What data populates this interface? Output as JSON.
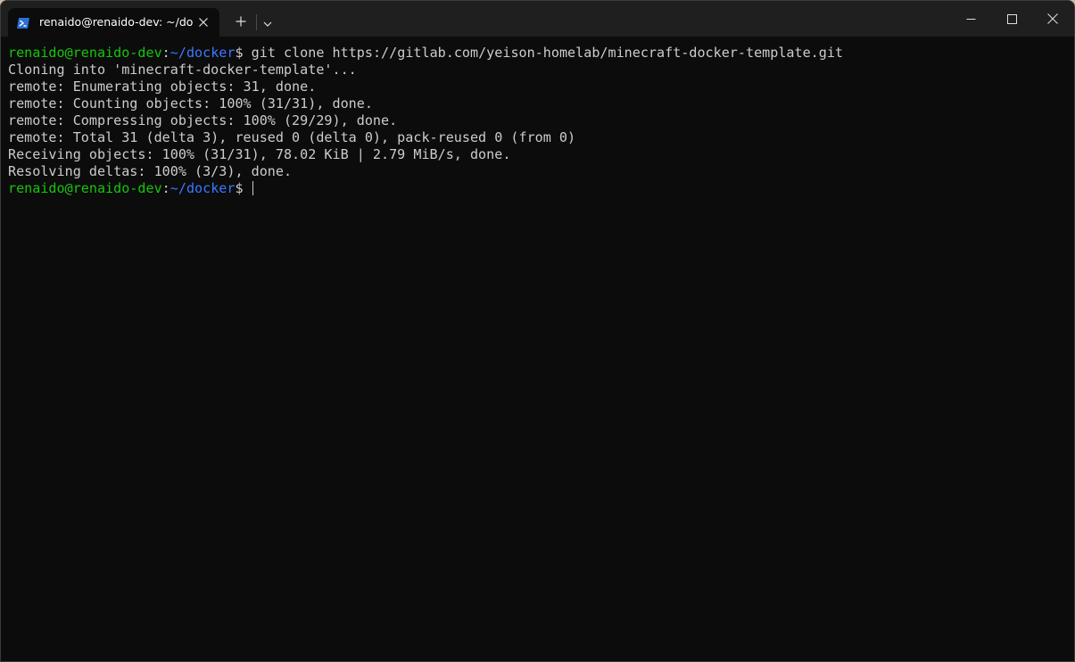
{
  "tab": {
    "title": "renaido@renaido-dev: ~/docker",
    "icon": "powershell-icon",
    "close_icon": "close-icon"
  },
  "titlebar": {
    "new_tab_icon": "plus-icon",
    "dropdown_icon": "chevron-down-icon",
    "minimize_icon": "minimize-icon",
    "maximize_icon": "maximize-icon",
    "close_icon": "close-icon"
  },
  "terminal": {
    "prompt1": {
      "user_host": "renaido@renaido-dev",
      "sep": ":",
      "path": "~/docker",
      "dollar": "$ ",
      "command": "git clone https://gitlab.com/yeison-homelab/minecraft-docker-template.git"
    },
    "output": [
      "Cloning into 'minecraft-docker-template'...",
      "remote: Enumerating objects: 31, done.",
      "remote: Counting objects: 100% (31/31), done.",
      "remote: Compressing objects: 100% (29/29), done.",
      "remote: Total 31 (delta 3), reused 0 (delta 0), pack-reused 0 (from 0)",
      "Receiving objects: 100% (31/31), 78.02 KiB | 2.79 MiB/s, done.",
      "Resolving deltas: 100% (3/3), done."
    ],
    "prompt2": {
      "user_host": "renaido@renaido-dev",
      "sep": ":",
      "path": "~/docker",
      "dollar": "$ "
    }
  },
  "colors": {
    "user_host": "#16c60c",
    "path": "#3b78ff",
    "text": "#cccccc",
    "background": "#0c0c0c",
    "titlebar": "#1f1f1f"
  }
}
